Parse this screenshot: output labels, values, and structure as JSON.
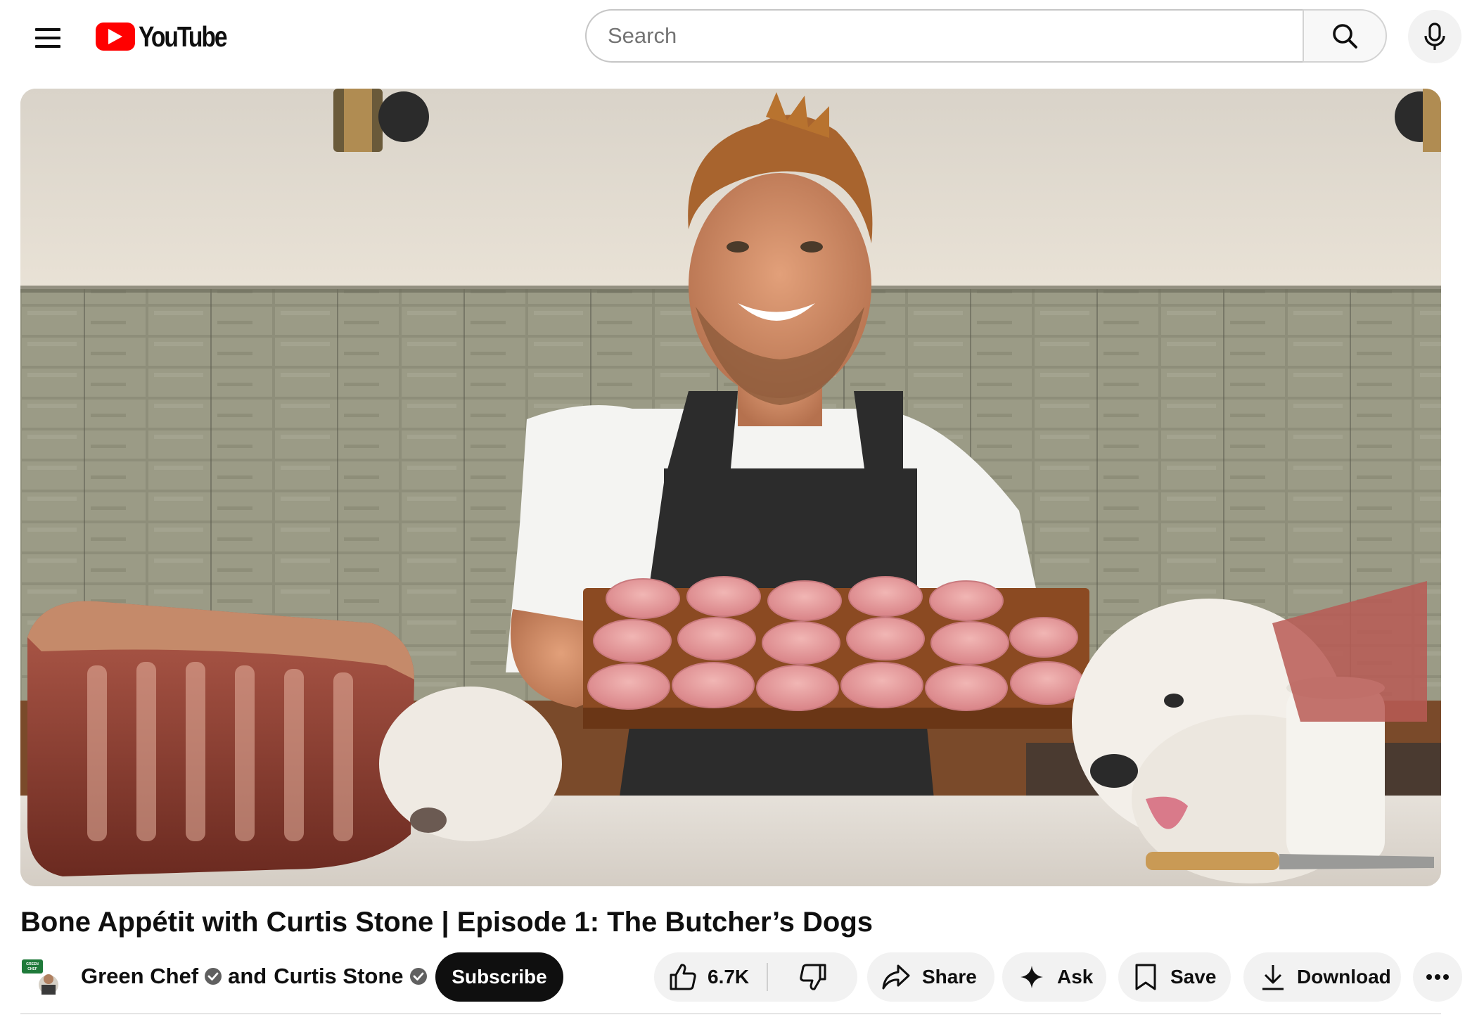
{
  "header": {
    "logo_text": "YouTube",
    "search_placeholder": "Search",
    "icons": {
      "menu": "hamburger-menu-icon",
      "search": "search-icon",
      "mic": "microphone-icon"
    }
  },
  "video": {
    "title": "Bone Appétit with Curtis Stone | Episode 1: The Butcher’s Dogs",
    "thumbnail_subject": "chef holding a wooden board of raw pork chops beside a rib roast and two white fluffy dogs, green tiled wall behind"
  },
  "owner": {
    "avatar_text": "GREEN CHEF",
    "channel_primary": "Green Chef",
    "joiner": "and",
    "channel_secondary": "Curtis Stone",
    "subscribe_label": "Subscribe"
  },
  "actions": {
    "like_count": "6.7K",
    "share_label": "Share",
    "ask_label": "Ask",
    "save_label": "Save",
    "download_label": "Download"
  },
  "colors": {
    "brand_red": "#ff0000",
    "text": "#0f0f0f",
    "pill_bg": "#f2f2f2",
    "subscribe_bg": "#0f0f0f",
    "avatar_green": "#1f7a3a"
  }
}
